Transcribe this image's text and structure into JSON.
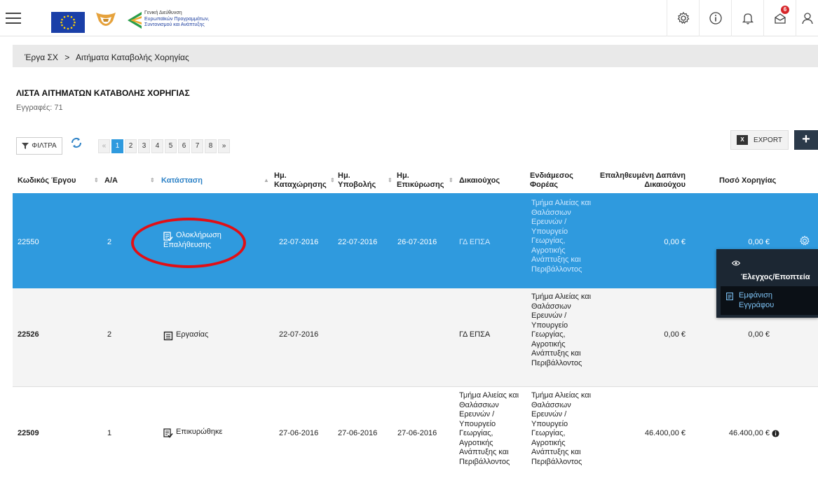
{
  "header": {
    "gov_logo_line1": "Γενική Διεύθυνση",
    "gov_logo_line2": "Ευρωπαϊκών Προγραμμάτων,",
    "gov_logo_line3": "Συντονισμού και Ανάπτυξης",
    "notification_count": "6",
    "icons": [
      "menu-icon",
      "gear-icon",
      "info-icon",
      "bell-icon",
      "envelope-icon",
      "user-icon"
    ]
  },
  "breadcrumb": {
    "item1": "Έργα ΣΧ",
    "separator": ">",
    "item2": "Αιτήματα Καταβολής Χορηγίας"
  },
  "page": {
    "title": "ΛΙΣΤΑ ΑΙΤΗΜΑΤΩΝ ΚΑΤΑΒΟΛΗΣ ΧΟΡΗΓΙΑΣ",
    "records": "Εγγραφές: 71"
  },
  "toolbar": {
    "filter_label": "ΦΙΛΤΡΑ",
    "export_label": "EXPORT",
    "add_label": "+"
  },
  "pagination": {
    "prev": "«",
    "pages": [
      "1",
      "2",
      "3",
      "4",
      "5",
      "6",
      "7",
      "8"
    ],
    "current": "1",
    "next": "»"
  },
  "table": {
    "headers": {
      "code": "Κωδικός Έργου",
      "aa": "Α/Α",
      "status": "Κατάσταση",
      "registration_l1": "Ημ.",
      "registration_l2": "Καταχώρησης",
      "submission_l1": "Ημ.",
      "submission_l2": "Υποβολής",
      "validation_l1": "Ημ.",
      "validation_l2": "Επικύρωσης",
      "beneficiary": "Δικαιούχος",
      "intermediate_l1": "Ενδιάμεσος",
      "intermediate_l2": "Φορέας",
      "verified_l1": "Επαληθευμένη Δαπάνη",
      "verified_l2": "Δικαιούχου",
      "amount": "Ποσό Χορηγίας"
    },
    "rows": [
      {
        "code": "22550",
        "aa": "2",
        "status_l1": "Ολοκλήρωση",
        "status_l2": "Επαλήθευσης",
        "registration": "22-07-2016",
        "submission": "22-07-2016",
        "validation": "26-07-2016",
        "beneficiary": [
          "ΓΔ ΕΠΣΑ"
        ],
        "intermediate": [
          "Τμήμα Αλιείας και",
          "Θαλάσσιων",
          "Ερευνών /",
          "Υπουργείο",
          "Γεωργίας,",
          "Αγροτικής",
          "Ανάπτυξης και",
          "Περιβάλλοντος"
        ],
        "verified": "0,00 €",
        "amount": "0,00 €"
      },
      {
        "code": "22526",
        "aa": "2",
        "status_l1": "Εργασίας",
        "status_l2": "",
        "registration": "22-07-2016",
        "submission": "",
        "validation": "",
        "beneficiary": [
          "ΓΔ ΕΠΣΑ"
        ],
        "intermediate": [
          "Τμήμα Αλιείας και",
          "Θαλάσσιων",
          "Ερευνών /",
          "Υπουργείο",
          "Γεωργίας,",
          "Αγροτικής",
          "Ανάπτυξης και",
          "Περιβάλλοντος"
        ],
        "verified": "0,00 €",
        "amount": "0,00 €"
      },
      {
        "code": "22509",
        "aa": "1",
        "status_l1": "Επικυρώθηκε",
        "status_l2": "",
        "registration": "27-06-2016",
        "submission": "27-06-2016",
        "validation": "27-06-2016",
        "beneficiary": [
          "Τμήμα Αλιείας και",
          "Θαλάσσιων",
          "Ερευνών /",
          "Υπουργείο",
          "Γεωργίας,",
          "Αγροτικής",
          "Ανάπτυξης και",
          "Περιβάλλοντος"
        ],
        "intermediate": [
          "Τμήμα Αλιείας και",
          "Θαλάσσιων",
          "Ερευνών /",
          "Υπουργείο",
          "Γεωργίας,",
          "Αγροτικής",
          "Ανάπτυξης και",
          "Περιβάλλοντος"
        ],
        "verified": "46.400,00 €",
        "amount": "46.400,00 €"
      }
    ]
  },
  "context_menu": {
    "item1": "Έλεγχος/Εποπτεία",
    "item2_l1": "Εμφάνιση",
    "item2_l2": "Εγγράφου"
  },
  "colors": {
    "selected_row": "#2f9ade",
    "accent_link": "#2f83c7",
    "annotation_circle": "#e10f16",
    "menu_bg": "#1c2733"
  }
}
